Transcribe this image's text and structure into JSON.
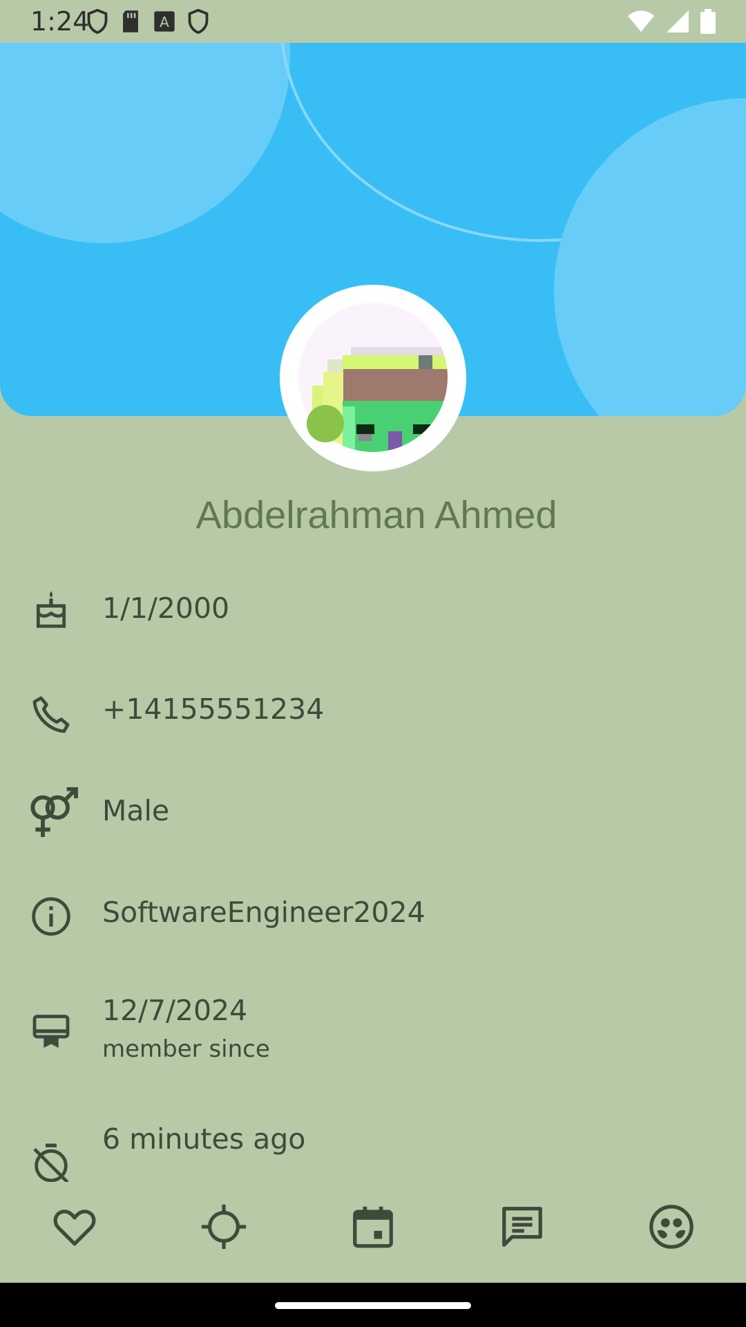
{
  "status_bar": {
    "time": "1:24",
    "left_icons": [
      "shield-icon",
      "sd-card-icon",
      "keyboard-a-icon",
      "shield-icon"
    ],
    "right_icons": [
      "wifi-icon",
      "cell-signal-icon",
      "battery-icon"
    ]
  },
  "profile": {
    "name": "Abdelrahman Ahmed",
    "online": true,
    "online_color": "#8bc34a",
    "header_color": "#38bef5"
  },
  "info": {
    "birthday": {
      "icon": "cake-icon",
      "value": "1/1/2000"
    },
    "phone": {
      "icon": "phone-icon",
      "value": "+14155551234"
    },
    "gender": {
      "icon": "gender-icon",
      "value": "Male"
    },
    "about": {
      "icon": "info-icon",
      "value": "SoftwareEngineer2024"
    },
    "member": {
      "icon": "card-membership-icon",
      "value": "12/7/2024",
      "caption": "member since"
    },
    "last_seen": {
      "icon": "timer-off-icon",
      "value": "6 minutes ago"
    }
  },
  "bottom_nav": [
    {
      "icon": "heart-icon"
    },
    {
      "icon": "crosshair-icon"
    },
    {
      "icon": "calendar-icon"
    },
    {
      "icon": "chat-icon"
    },
    {
      "icon": "face-icon"
    }
  ]
}
